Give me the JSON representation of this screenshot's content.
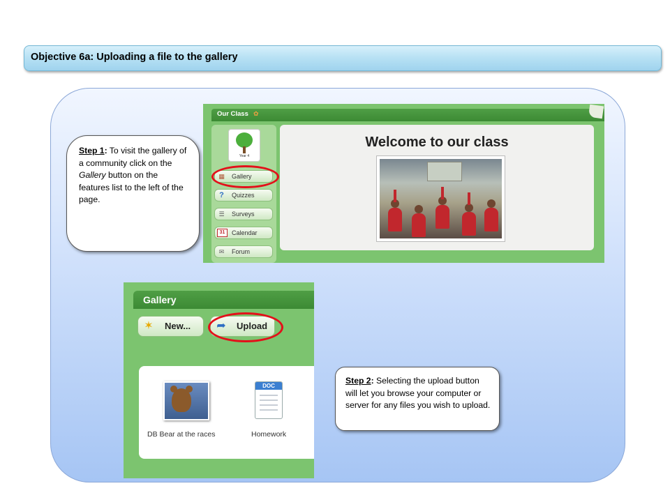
{
  "title": "Objective 6a: Uploading a file to the gallery",
  "step1": {
    "label": "Step 1",
    "colon": ":",
    "text_before": " To visit the gallery of a community click on the ",
    "gallery_word": "Gallery",
    "text_after": " button on the features list to the left of the page."
  },
  "step2": {
    "label": "Step 2",
    "colon": ":",
    "text": " Selecting the upload button will let you browse your computer or server for any files you wish to upload."
  },
  "our_class": {
    "header_title": "Our Class",
    "logo_caption": "Year 4",
    "welcome": "Welcome to our class",
    "nav": [
      {
        "label": "Gallery",
        "icon": "gallery-icon"
      },
      {
        "label": "Quizzes",
        "icon": "question-icon"
      },
      {
        "label": "Surveys",
        "icon": "survey-icon"
      },
      {
        "label": "Calendar",
        "icon": "calendar-icon",
        "icon_text": "31"
      },
      {
        "label": "Forum",
        "icon": "forum-icon"
      }
    ]
  },
  "gallery": {
    "header_title": "Gallery",
    "new_button": "New...",
    "upload_button": "Upload",
    "items": [
      {
        "caption": "DB Bear at the races"
      },
      {
        "caption": "Homework",
        "doc_tag": "DOC"
      }
    ]
  },
  "colors": {
    "highlight": "#e3101a",
    "app_green": "#7cc46f",
    "header_green": "#3c8a34"
  }
}
